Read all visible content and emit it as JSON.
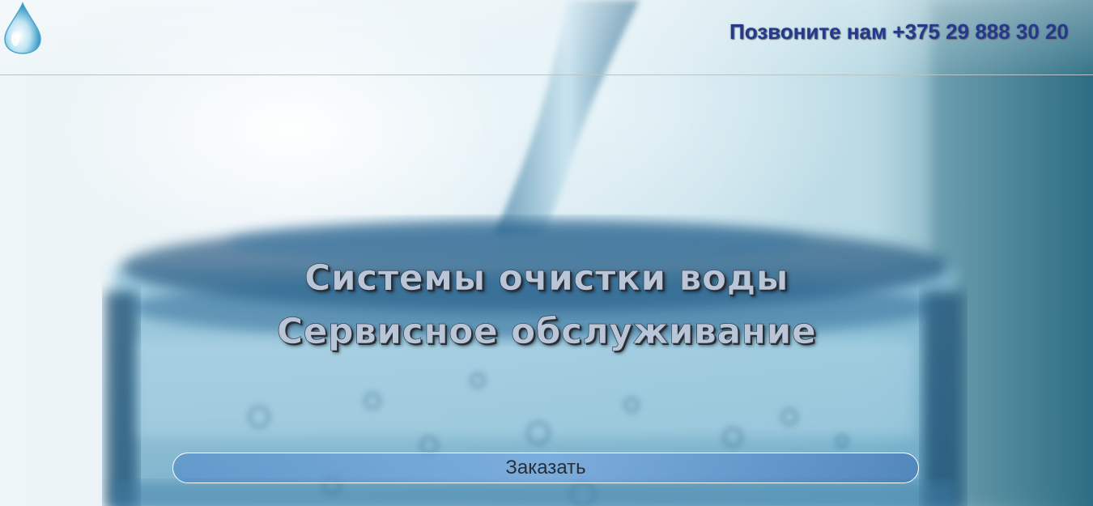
{
  "header": {
    "logo_icon": "water-drop-icon",
    "phone_text": "Позвоните нам +375 29 888 30 20"
  },
  "hero": {
    "background_image": "glass-of-water-photo",
    "title_line1": "Системы очистки воды",
    "title_line2": "Сервисное обслуживание",
    "order_button_label": "Заказать"
  },
  "colors": {
    "phone_text": "#233a8c",
    "headline_fill": "#b9c6d8",
    "button_fill": "#6fa3da",
    "header_border": "#b9c4c6"
  }
}
